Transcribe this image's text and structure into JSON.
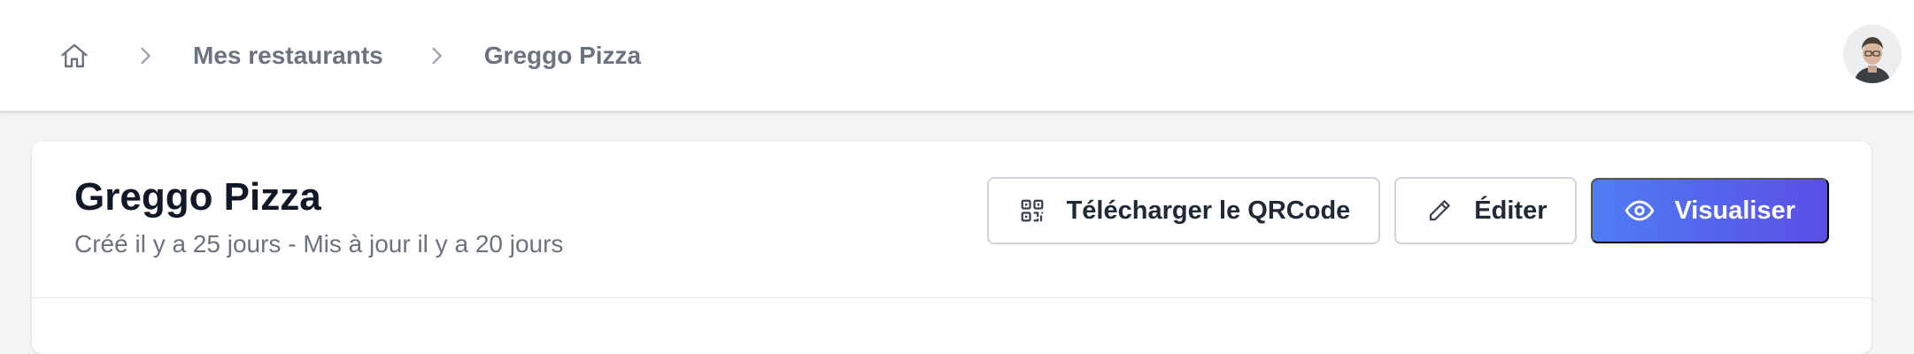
{
  "topbar": {
    "breadcrumb": [
      {
        "label": "Mes restaurants"
      },
      {
        "label": "Greggo Pizza"
      }
    ]
  },
  "restaurant": {
    "title": "Greggo Pizza",
    "meta": "Créé il y a 25 jours - Mis à jour il y a 20 jours"
  },
  "actions": {
    "qr_label": "Télécharger le QRCode",
    "edit_label": "Éditer",
    "view_label": "Visualiser"
  },
  "colors": {
    "primary_start": "#4f7df4",
    "primary_end": "#5b4ee6",
    "muted_text": "#6b7280",
    "title_text": "#111827"
  }
}
